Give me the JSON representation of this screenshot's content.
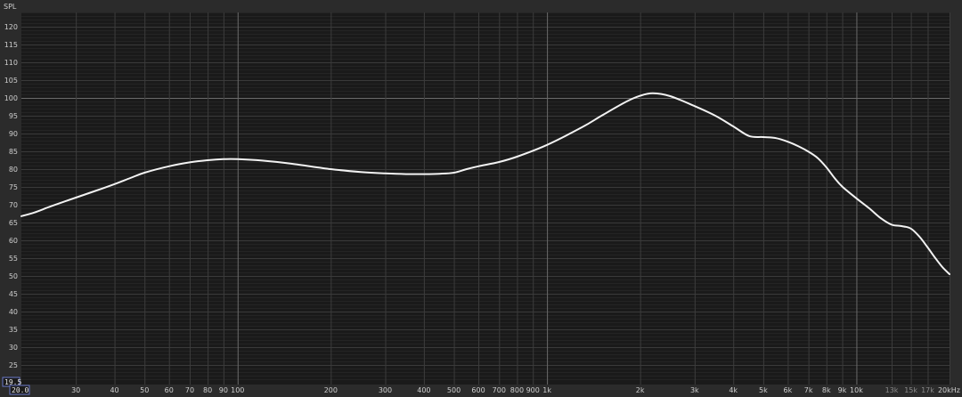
{
  "chart_data": {
    "type": "line",
    "ylabel": "SPL",
    "x_unit": "Hz",
    "x_scale": "log",
    "xlim": [
      20,
      20000
    ],
    "ylim": [
      19.5,
      124
    ],
    "y_ticks": [
      25,
      30,
      35,
      40,
      45,
      50,
      55,
      60,
      65,
      70,
      75,
      80,
      85,
      90,
      95,
      100,
      105,
      110,
      115,
      120
    ],
    "x_ticks": [
      {
        "v": 30,
        "label": "30"
      },
      {
        "v": 40,
        "label": "40"
      },
      {
        "v": 50,
        "label": "50"
      },
      {
        "v": 60,
        "label": "60"
      },
      {
        "v": 70,
        "label": "70"
      },
      {
        "v": 80,
        "label": "80"
      },
      {
        "v": 90,
        "label": "90"
      },
      {
        "v": 100,
        "label": "100"
      },
      {
        "v": 200,
        "label": "200"
      },
      {
        "v": 300,
        "label": "300"
      },
      {
        "v": 400,
        "label": "400"
      },
      {
        "v": 500,
        "label": "500"
      },
      {
        "v": 600,
        "label": "600"
      },
      {
        "v": 700,
        "label": "700"
      },
      {
        "v": 800,
        "label": "800"
      },
      {
        "v": 900,
        "label": "900"
      },
      {
        "v": 1000,
        "label": "1k"
      },
      {
        "v": 2000,
        "label": "2k"
      },
      {
        "v": 3000,
        "label": "3k"
      },
      {
        "v": 4000,
        "label": "4k"
      },
      {
        "v": 5000,
        "label": "5k"
      },
      {
        "v": 6000,
        "label": "6k"
      },
      {
        "v": 7000,
        "label": "7k"
      },
      {
        "v": 8000,
        "label": "8k"
      },
      {
        "v": 9000,
        "label": "9k"
      },
      {
        "v": 10000,
        "label": "10k"
      },
      {
        "v": 13000,
        "label": "13k",
        "dim": true
      },
      {
        "v": 15000,
        "label": "15k",
        "dim": true
      },
      {
        "v": 17000,
        "label": "17k",
        "dim": true
      },
      {
        "v": 20000,
        "label": "20kHz"
      }
    ],
    "corner_labels": {
      "y_min": "19.5",
      "x_min": "20.0"
    },
    "grid": true,
    "line_color": "#f2f2f2",
    "background_color": "#1a1a1a",
    "series": [
      {
        "x": [
          20,
          22,
          25,
          30,
          35,
          40,
          45,
          50,
          60,
          70,
          80,
          90,
          100,
          120,
          150,
          200,
          250,
          300,
          350,
          400,
          450,
          500,
          550,
          600,
          700,
          800,
          1000,
          1300,
          1500,
          1800,
          2000,
          2200,
          2500,
          3000,
          3500,
          4000,
          4500,
          5000,
          5500,
          6000,
          6500,
          7000,
          7500,
          8000,
          8500,
          9000,
          10000,
          11000,
          12000,
          13000,
          14000,
          15000,
          16000,
          17000,
          18000,
          19000,
          20000
        ],
        "y": [
          66.8,
          67.8,
          69.6,
          72.0,
          74.0,
          75.8,
          77.5,
          79.0,
          80.8,
          81.9,
          82.5,
          82.8,
          82.8,
          82.4,
          81.5,
          80.0,
          79.2,
          78.8,
          78.6,
          78.6,
          78.7,
          79.0,
          80.0,
          80.8,
          82.0,
          83.5,
          86.8,
          91.8,
          95.0,
          98.9,
          100.6,
          101.3,
          100.5,
          97.7,
          95.0,
          92.0,
          89.3,
          89.0,
          88.7,
          87.7,
          86.4,
          84.9,
          83.1,
          80.5,
          77.5,
          75.1,
          71.8,
          69.0,
          66.2,
          64.4,
          64.0,
          63.3,
          61.0,
          58.0,
          55.0,
          52.4,
          50.5
        ]
      }
    ]
  }
}
